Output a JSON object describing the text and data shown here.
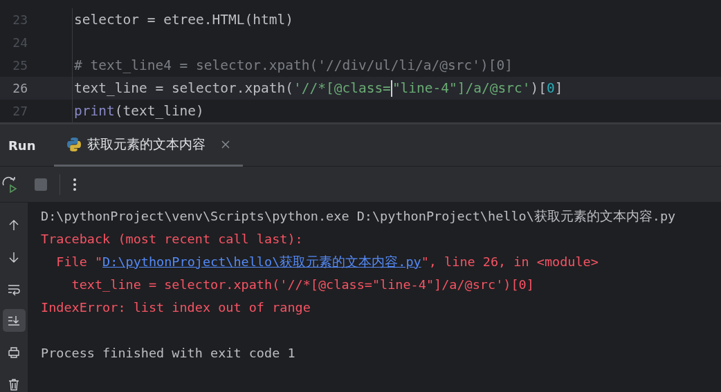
{
  "editor": {
    "lines": [
      {
        "number": "23",
        "current": false,
        "tokens": [
          {
            "kind": "plain",
            "text": "selector = etree.HTML(html)"
          }
        ]
      },
      {
        "number": "24",
        "current": false
      },
      {
        "number": "25",
        "current": false,
        "tokens": [
          {
            "kind": "comment",
            "text": "# text_line4 = selector.xpath('//div/ul/li/a/@src')[0]"
          }
        ]
      },
      {
        "number": "26",
        "current": true,
        "tokens": [
          {
            "kind": "plain",
            "text": "text_line = selector.xpath("
          },
          {
            "kind": "string",
            "text": "'//*[@class="
          },
          {
            "kind": "caret"
          },
          {
            "kind": "string",
            "text": "\"line-4\"]/a/@src'"
          },
          {
            "kind": "plain",
            "text": ")["
          },
          {
            "kind": "number",
            "text": "0"
          },
          {
            "kind": "plain",
            "text": "]"
          }
        ]
      },
      {
        "number": "27",
        "current": false,
        "tokens": [
          {
            "kind": "builtin",
            "text": "print"
          },
          {
            "kind": "plain",
            "text": "(text_line)"
          }
        ]
      }
    ]
  },
  "run_panel": {
    "title": "Run",
    "tabs": [
      {
        "label": "获取元素的文本内容",
        "selected": true
      }
    ],
    "toolbar": {
      "stop_disabled": true
    },
    "side_tools": [
      {
        "kind": "up",
        "selected": false
      },
      {
        "kind": "down",
        "selected": false
      },
      {
        "kind": "wrap",
        "selected": false
      },
      {
        "kind": "scroll-end",
        "selected": true
      },
      {
        "kind": "print",
        "selected": false
      },
      {
        "kind": "trash",
        "selected": false
      }
    ],
    "console": [
      {
        "kind": "output",
        "segments": [
          {
            "kind": "plain",
            "text": "D:\\pythonProject\\venv\\Scripts\\python.exe D:\\pythonProject\\hello\\获取元素的文本内容.py"
          }
        ]
      },
      {
        "kind": "output",
        "segments": [
          {
            "kind": "error",
            "text": "Traceback (most recent call last):"
          }
        ]
      },
      {
        "kind": "output",
        "segments": [
          {
            "kind": "error",
            "text": "  File \""
          },
          {
            "kind": "link",
            "text": "D:\\pythonProject\\hello\\获取元素的文本内容.py"
          },
          {
            "kind": "error",
            "text": "\", line 26, in <module>"
          }
        ]
      },
      {
        "kind": "output",
        "segments": [
          {
            "kind": "error",
            "text": "    text_line = selector.xpath('//*[@class=\"line-4\"]/a/@src')[0]"
          }
        ]
      },
      {
        "kind": "output",
        "segments": [
          {
            "kind": "error",
            "text": "IndexError: list index out of range"
          }
        ]
      },
      {
        "kind": "blank"
      },
      {
        "kind": "output",
        "segments": [
          {
            "kind": "plain",
            "text": "Process finished with exit code 1"
          }
        ]
      }
    ]
  }
}
